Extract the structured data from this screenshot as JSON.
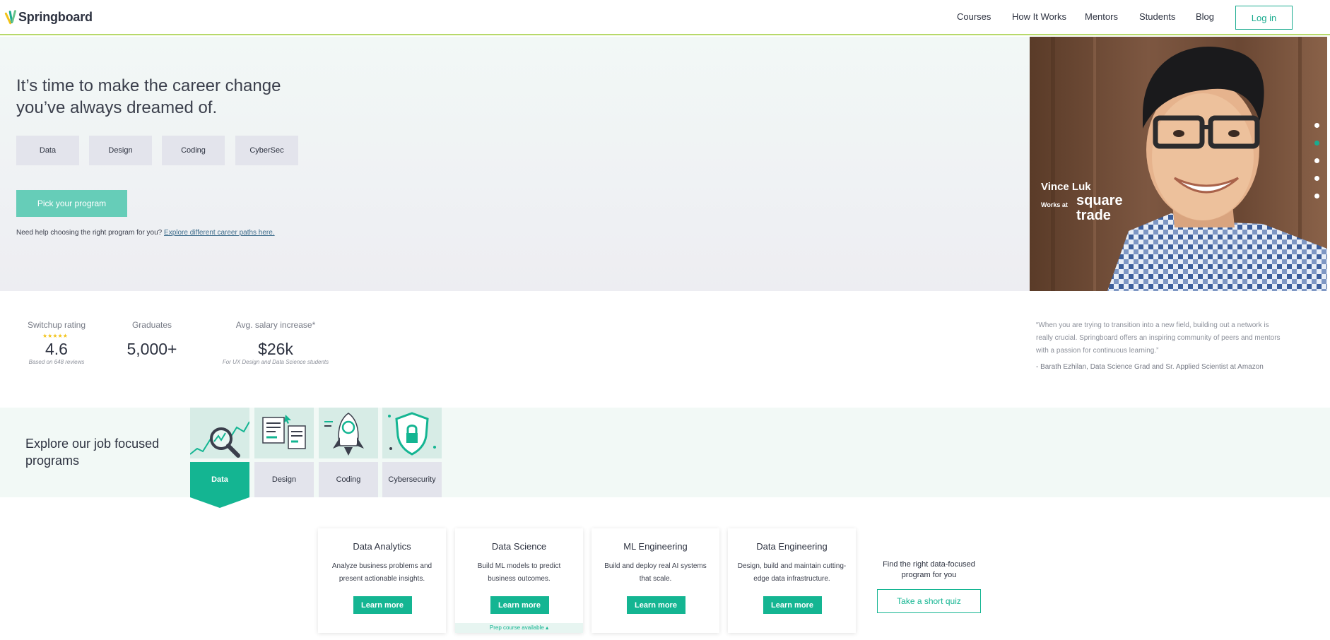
{
  "header": {
    "logo_text": "Springboard",
    "nav": [
      "Courses",
      "How It Works",
      "Mentors",
      "Students",
      "Blog"
    ],
    "login_label": "Log in"
  },
  "hero": {
    "title": "It’s time to make the career change you’ve always dreamed of.",
    "chips": [
      "Data",
      "Design",
      "Coding",
      "CyberSec"
    ],
    "cta_label": "Pick your program",
    "help_text": "Need help choosing the right program for you?",
    "help_link": "Explore different career paths here.",
    "person_name": "Vince Luk",
    "works_at": "Works at",
    "company_logo": "square trade",
    "carousel_active": 2
  },
  "stats": [
    {
      "label": "Switchup rating",
      "value": "4.6",
      "note": "Based on 648 reviews",
      "stars": "★★★★★"
    },
    {
      "label": "Graduates",
      "value": "5,000+",
      "note": ""
    },
    {
      "label": "Avg. salary increase*",
      "value": "$26k",
      "note": "For UX Design and Data Science students"
    }
  ],
  "quote": {
    "text": "“When you are trying to transition into a new field, building out a network is really crucial. Springboard offers an inspiring community of peers and mentors with a passion for continuous learning.”",
    "author": "- Barath Ezhilan, Data Science Grad and Sr. Applied Scientist at Amazon"
  },
  "explore": {
    "title": "Explore our job focused programs",
    "tabs": [
      "Data",
      "Design",
      "Coding",
      "Cybersecurity"
    ],
    "active_tab": "Data"
  },
  "cards": [
    {
      "title": "Data Analytics",
      "desc": "Analyze business problems and present actionable insights.",
      "button": "Learn more"
    },
    {
      "title": "Data Science",
      "desc": "Build ML models to predict business outcomes.",
      "button": "Learn more",
      "prep": "Prep course available ▴"
    },
    {
      "title": "ML Engineering",
      "desc": "Build and deploy real AI systems that scale.",
      "button": "Learn more"
    },
    {
      "title": "Data Engineering",
      "desc": "Design, build and maintain cutting-edge data infrastructure.",
      "button": "Learn more"
    }
  ],
  "quiz": {
    "text": "Find the right data-focused program for you",
    "button": "Take a short quiz"
  },
  "colors": {
    "accent": "#14b592",
    "cta_light": "#66cdb8",
    "chip_bg": "#e3e4ec"
  }
}
